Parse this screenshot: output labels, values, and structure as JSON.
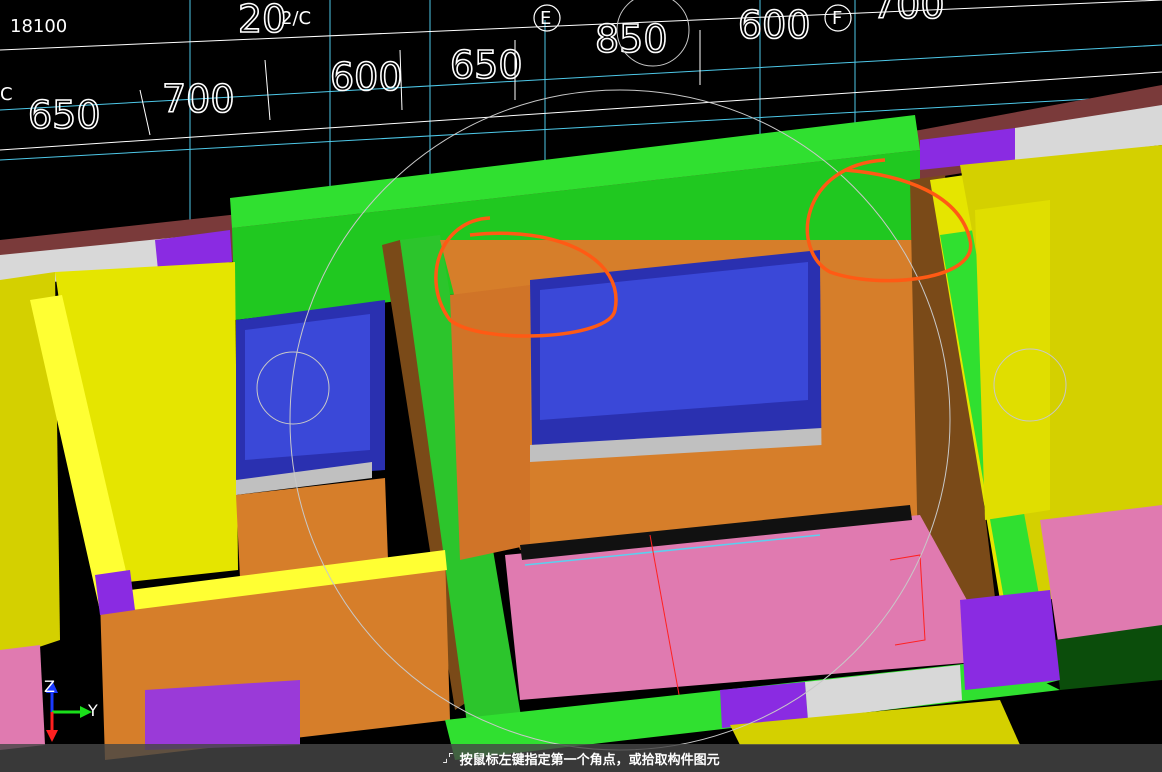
{
  "canvas": {
    "dimension_labels": {
      "d1": "18100",
      "d2": "20",
      "d3": "2/C",
      "d4": "E",
      "d5": "850",
      "d6": "600",
      "d7": "F",
      "d8": "700",
      "d9": "650",
      "d10": "700",
      "d11": "600",
      "d12": "650",
      "d13": "C"
    },
    "axis": {
      "z": "Z",
      "y": "Y"
    },
    "colors": {
      "background": "#000000",
      "beam": "#1adf1a",
      "wall": "#d67e2a",
      "wall_dark": "#7a4a18",
      "column": "#e5e500",
      "slab": "#e07ab0",
      "window": "#3340c8",
      "purple": "#8a2be2",
      "annotation": "#ff5a14"
    }
  },
  "status": {
    "message": "按鼠标左键指定第一个角点，或拾取构件图元"
  }
}
